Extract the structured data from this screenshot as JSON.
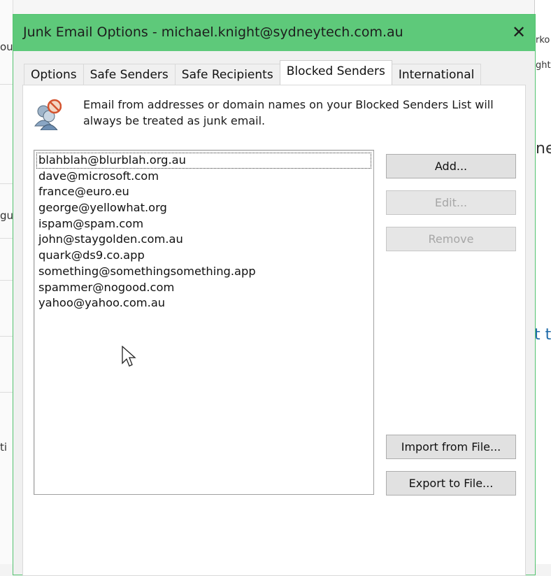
{
  "background": {
    "frag_top": "...",
    "frag_left1": "ou",
    "frag_left2": "gu",
    "frag_left3": "ti",
    "frag_right1": "rko",
    "frag_right2": "ght",
    "frag_right3": "ne",
    "frag_right4": "t t"
  },
  "dialog": {
    "title": "Junk Email Options - michael.knight@sydneytech.com.au",
    "close_label": "✕"
  },
  "tabs": [
    {
      "label": "Options"
    },
    {
      "label": "Safe Senders"
    },
    {
      "label": "Safe Recipients"
    },
    {
      "label": "Blocked Senders"
    },
    {
      "label": "International"
    }
  ],
  "info": {
    "text": "Email from addresses or domain names on your Blocked Senders List will always be treated as junk email.",
    "icon": "blocked-senders-icon"
  },
  "blocked_list": [
    "blahblah@blurblah.org.au",
    "dave@microsoft.com",
    "france@euro.eu",
    "george@yellowhat.org",
    "ispam@spam.com",
    "john@staygolden.com.au",
    "quark@ds9.co.app",
    "something@somethingsomething.app",
    "spammer@nogood.com",
    "yahoo@yahoo.com.au"
  ],
  "buttons": {
    "add": "Add...",
    "edit": "Edit...",
    "remove": "Remove",
    "import": "Import from File...",
    "export": "Export to File..."
  },
  "colors": {
    "title_bar": "#5ec97a",
    "dialog_bg": "#f0f0f0"
  }
}
